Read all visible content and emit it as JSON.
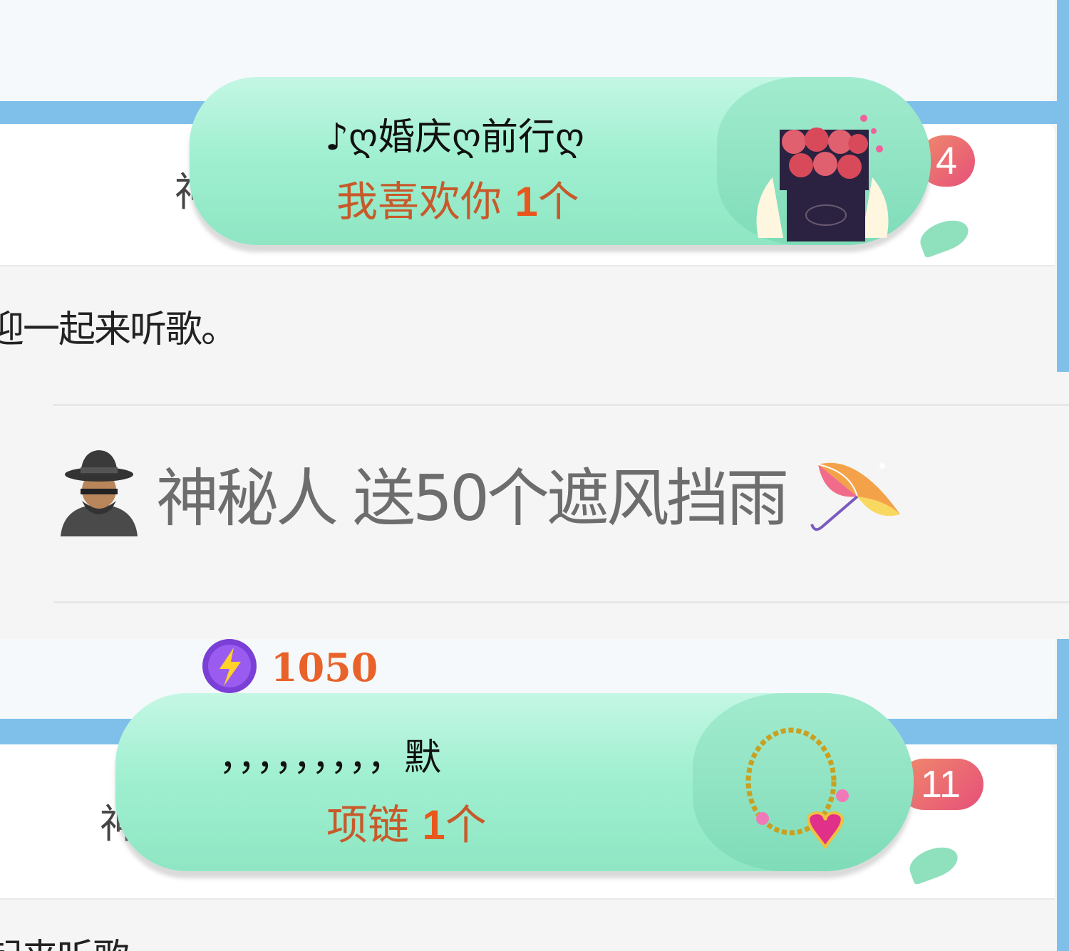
{
  "top_card": {
    "partial_name_char": "神",
    "message_fragment": "迎一起来听歌。",
    "badge_count": "4",
    "bubble": {
      "sender": "♪ღ婚庆ღ前行ღ",
      "gift_name": "我喜欢你",
      "gift_count": "1",
      "gift_unit": "个",
      "gift_icon": "rose-box-icon"
    }
  },
  "gift_notice": {
    "avatar_icon": "mystery-person-icon",
    "text": "神秘人 送50个遮风挡雨",
    "gift_icon": "umbrella-icon"
  },
  "bottom_card": {
    "energy_value": "1050",
    "energy_icon": "lightning-icon",
    "partial_name_char": "神",
    "message_fragment": "起来听歌",
    "badge_count": "11",
    "bubble": {
      "sender": "，，，，，，，，，默",
      "gift_name": "项链",
      "gift_count": "1",
      "gift_unit": "个",
      "gift_icon": "necklace-icon"
    }
  }
}
